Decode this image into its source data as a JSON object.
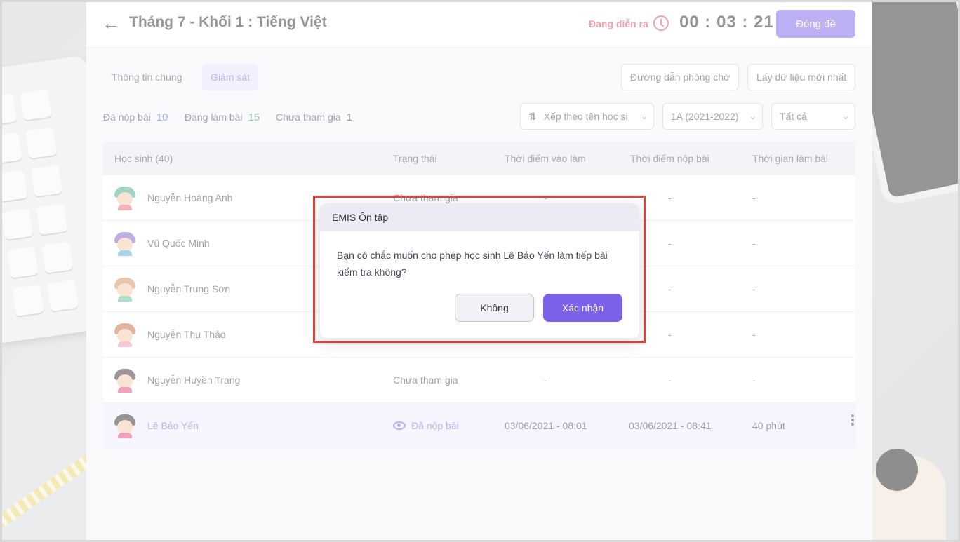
{
  "header": {
    "title": "Tháng 7 - Khối 1 : Tiếng Việt",
    "status": "Đang diễn ra",
    "timer": "00 : 03 : 21",
    "close_label": "Đóng đề"
  },
  "tabs": [
    {
      "label": "Thông tin chung",
      "active": false
    },
    {
      "label": "Giám sát",
      "active": true
    }
  ],
  "actions": {
    "waiting_room_link": "Đường dẫn phòng chờ",
    "refresh_data": "Lấy dữ liệu mới nhất"
  },
  "stats": {
    "submitted_label": "Đã nộp bài",
    "submitted_count": "10",
    "working_label": "Đang làm bài",
    "working_count": "15",
    "absent_label": "Chưa tham gia",
    "absent_count": "1"
  },
  "filters": {
    "sort": "Xếp theo tên học si",
    "class": "1A (2021-2022)",
    "status": "Tất cả"
  },
  "table": {
    "columns": [
      "Học sinh (40)",
      "Trạng thái",
      "Thời điểm vào làm",
      "Thời điểm nộp bài",
      "Thời gian làm bài"
    ],
    "rows": [
      {
        "name": "Nguyễn Hoàng Anh",
        "status": "Chưa tham gia",
        "start": "-",
        "submit": "-",
        "duration": "-"
      },
      {
        "name": "Vũ Quốc Minh",
        "status": "",
        "start": "",
        "submit": "-",
        "duration": "-"
      },
      {
        "name": "Nguyễn Trung Sơn",
        "status": "",
        "start": "",
        "submit": "-",
        "duration": "-"
      },
      {
        "name": "Nguyễn Thu Thảo",
        "status": "",
        "start": "",
        "submit": "-",
        "duration": "-"
      },
      {
        "name": "Nguyễn Huyền Trang",
        "status": "Chưa tham gia",
        "start": "-",
        "submit": "-",
        "duration": "-"
      },
      {
        "name": "Lê Bảo Yến",
        "status": "Đã nộp bài",
        "start": "03/06/2021 - 08:01",
        "submit": "03/06/2021 - 08:41",
        "duration": "40 phút"
      }
    ]
  },
  "dialog": {
    "title": "EMIS Ôn tập",
    "message": "Bạn có chắc muốn cho phép học sinh Lê Bảo Yến làm tiếp bài kiểm tra không?",
    "cancel": "Không",
    "confirm": "Xác nhận"
  },
  "colors": {
    "accent": "#7b61e8",
    "live": "#e2445c",
    "highlight": "#e0453d"
  }
}
